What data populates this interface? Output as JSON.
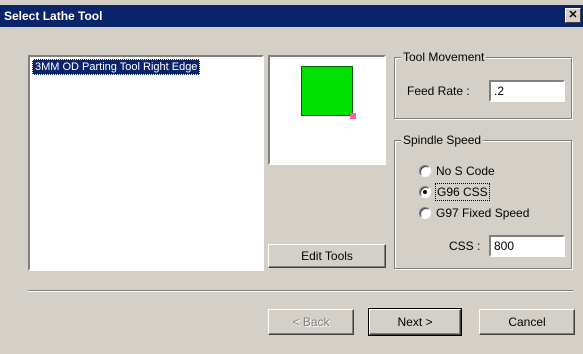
{
  "window": {
    "title": "Select Lathe Tool",
    "close_glyph": "✕"
  },
  "tool_list": {
    "items": [
      "3MM OD Parting Tool Right Edge"
    ],
    "selected_index": 0
  },
  "preview": {
    "tool_color": "#00e000"
  },
  "edit_tools_label": "Edit Tools",
  "tool_movement": {
    "group_label": "Tool Movement",
    "feed_rate_label": "Feed Rate :",
    "feed_rate_value": ".2"
  },
  "spindle_speed": {
    "group_label": "Spindle Speed",
    "options": [
      "No S Code",
      "G96 CSS",
      "G97 Fixed Speed"
    ],
    "selected": "G96 CSS",
    "css_label": "CSS :",
    "css_value": "800"
  },
  "footer": {
    "back_label": "< Back",
    "next_label": "Next >",
    "cancel_label": "Cancel"
  }
}
